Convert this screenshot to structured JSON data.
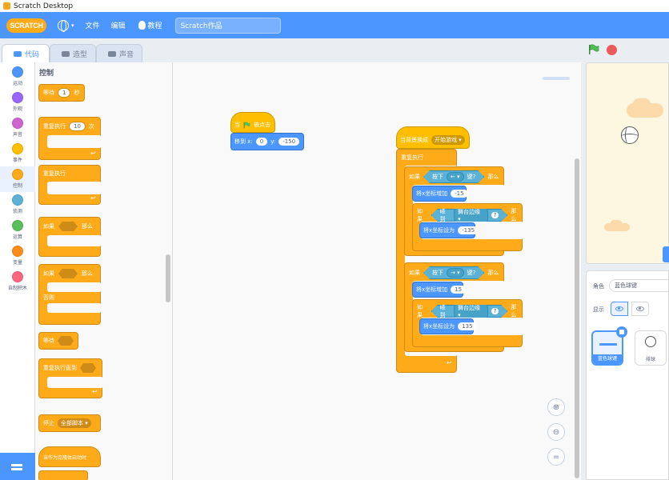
{
  "window": {
    "title": "Scratch Desktop"
  },
  "menubar": {
    "logo_text": "SCRATCH",
    "file_label": "文件",
    "edit_label": "编辑",
    "tutorials_label": "教程",
    "project_title": "Scratch作品"
  },
  "tabs": [
    {
      "label": "代码"
    },
    {
      "label": "造型"
    },
    {
      "label": "声音"
    }
  ],
  "categories": [
    {
      "label": "运动",
      "color": "#4c97ff"
    },
    {
      "label": "外观",
      "color": "#9966ff"
    },
    {
      "label": "声音",
      "color": "#cf63cf"
    },
    {
      "label": "事件",
      "color": "#ffbf00"
    },
    {
      "label": "控制",
      "color": "#ffab19"
    },
    {
      "label": "侦测",
      "color": "#5cb1d6"
    },
    {
      "label": "运算",
      "color": "#59c059"
    },
    {
      "label": "变量",
      "color": "#ff8c1a"
    },
    {
      "label": "自制积木",
      "color": "#ff6680"
    }
  ],
  "palette": {
    "title": "控制",
    "wait_label": "等待",
    "wait_value": "1",
    "wait_unit": "秒",
    "repeat_label": "重复执行",
    "repeat_value": "10",
    "repeat_unit": "次",
    "forever_label": "重复执行",
    "if_label": "如果",
    "then_label": "那么",
    "if2_label": "如果",
    "then2_label": "那么",
    "else_label": "否则",
    "wait_until_label": "等待",
    "repeat_until_label": "重复执行直到",
    "stop_label": "停止",
    "stop_option": "全部脚本 ▾",
    "clone_hat_label": "当作为克隆体启动时"
  },
  "script1": {
    "hat_when": "当",
    "hat_clicked": "被点击",
    "goto_label": "移到 x:",
    "x_value": "0",
    "y_label": "y:",
    "y_value": "-150"
  },
  "script2": {
    "hat_label": "当背景换成",
    "hat_option": "开始游戏 ▾",
    "forever_label": "重复执行",
    "if1_label": "如果",
    "key_pressed_label": "按下",
    "key1_option": "← ▾",
    "key_suffix": "键?",
    "then1_label": "那么",
    "change_x_label": "将x坐标增加",
    "change_x1_value": "-15",
    "if_inner1_label": "如果",
    "touching_label": "碰到",
    "touching_option": "舞台边缘 ▾",
    "q_mark": "?",
    "then_inner1_label": "那么",
    "set_x_label": "将x坐标设为",
    "set_x1_value": "-135",
    "if2_label": "如果",
    "key2_option": "→ ▾",
    "then2_label": "那么",
    "change_x2_value": "15",
    "if_inner2_label": "如果",
    "then_inner2_label": "那么",
    "set_x2_value": "135"
  },
  "sprite_panel": {
    "name_label": "角色",
    "name_value": "蓝色球键",
    "show_label": "显示",
    "sprites": [
      {
        "name": "蓝色球键"
      },
      {
        "name": "排球"
      }
    ]
  }
}
